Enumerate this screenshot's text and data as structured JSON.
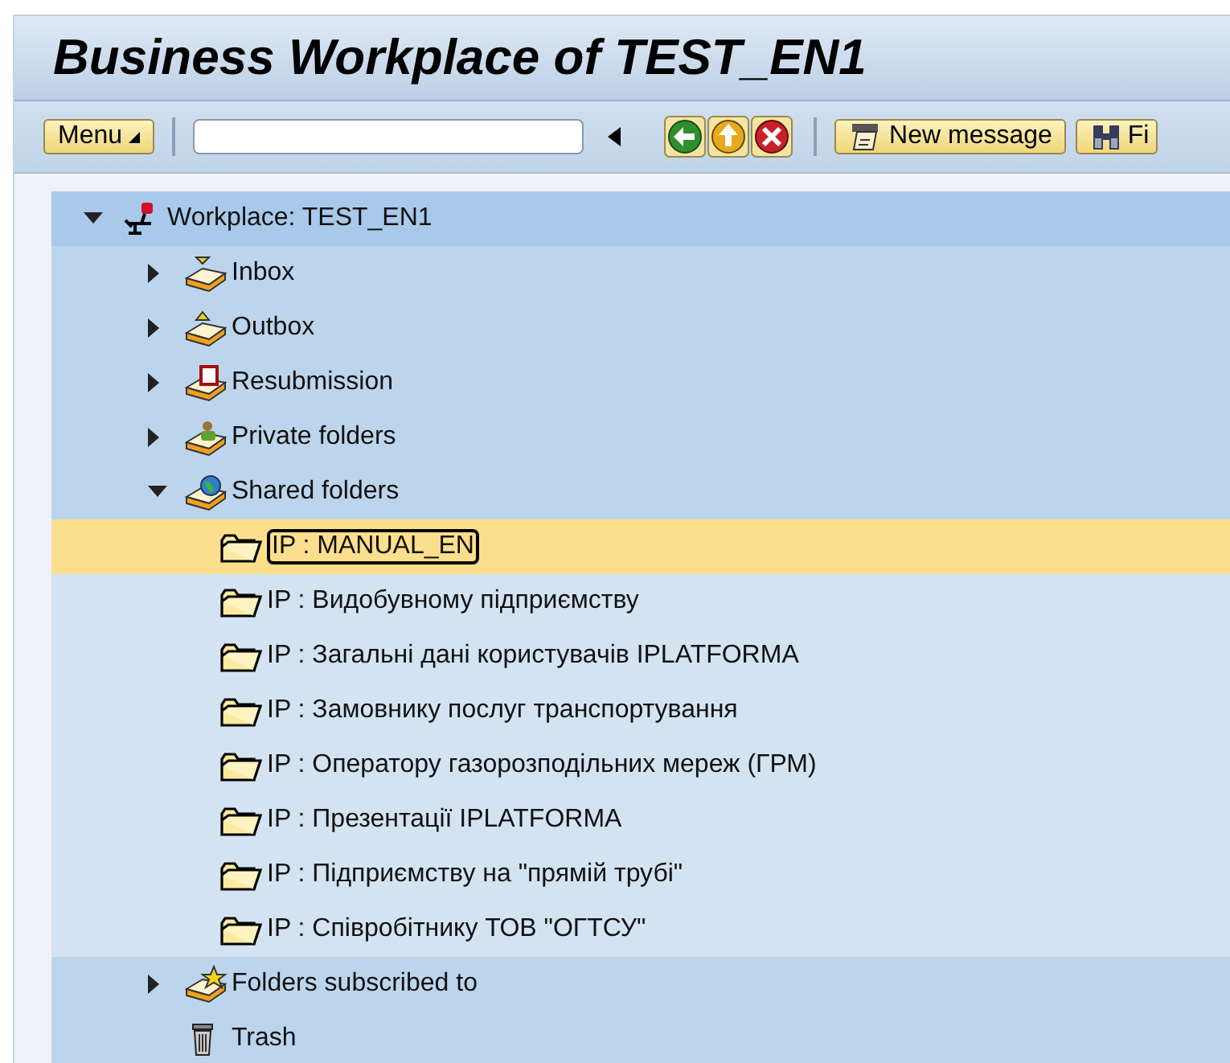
{
  "window": {
    "title": "Business Workplace of TEST_EN1"
  },
  "toolbar": {
    "menu_button": "Menu",
    "new_message_button": "New message",
    "find_button": "Fi"
  },
  "tree": {
    "label": "Workplace: TEST_EN1",
    "kind": "workplace",
    "expanded": true,
    "selected": false,
    "children": [
      {
        "label": "Inbox",
        "kind": "inbox",
        "expanded": false,
        "selected": false
      },
      {
        "label": "Outbox",
        "kind": "outbox",
        "expanded": false,
        "selected": false
      },
      {
        "label": "Resubmission",
        "kind": "resubmission",
        "expanded": false,
        "selected": false
      },
      {
        "label": "Private folders",
        "kind": "private",
        "expanded": false,
        "selected": false
      },
      {
        "label": "Shared folders",
        "kind": "shared",
        "expanded": true,
        "selected": false,
        "children": [
          {
            "label": "IP : MANUAL_EN",
            "kind": "folder",
            "selected": true
          },
          {
            "label": "IP : Видобувному підприємству",
            "kind": "folder",
            "selected": false
          },
          {
            "label": "IP : Загальні дані користувачів IPLATFORMA",
            "kind": "folder",
            "selected": false
          },
          {
            "label": "IP : Замовнику послуг транспортування",
            "kind": "folder",
            "selected": false
          },
          {
            "label": "IP : Оператору газорозподільних мереж (ГРМ)",
            "kind": "folder",
            "selected": false
          },
          {
            "label": "IP : Презентації IPLATFORMA",
            "kind": "folder",
            "selected": false
          },
          {
            "label": "IP : Підприємству на \"прямій трубі\"",
            "kind": "folder",
            "selected": false
          },
          {
            "label": "IP : Співробітнику ТОВ \"ОГТСУ\"",
            "kind": "folder",
            "selected": false
          }
        ]
      },
      {
        "label": "Folders subscribed to",
        "kind": "subscribed",
        "expanded": false,
        "selected": false
      },
      {
        "label": "Trash",
        "kind": "trash",
        "selected": false
      }
    ]
  }
}
